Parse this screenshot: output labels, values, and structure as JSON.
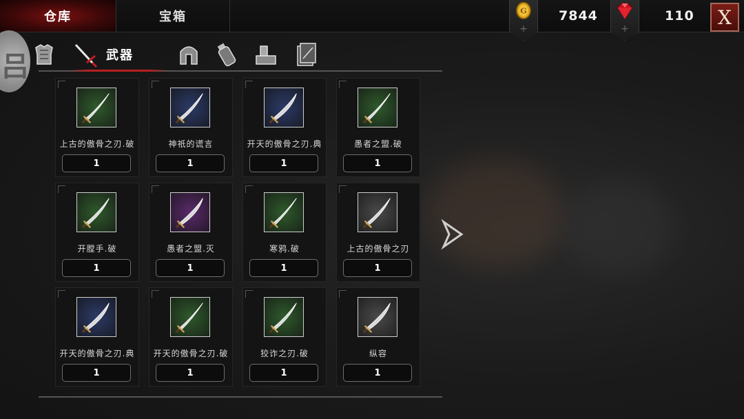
{
  "topbar": {
    "tabs": [
      {
        "label": "仓库",
        "active": true
      },
      {
        "label": "宝箱",
        "active": false
      }
    ],
    "gold": {
      "icon": "gold-coin-icon",
      "value": "7844"
    },
    "gems": {
      "icon": "red-gem-icon",
      "value": "110"
    },
    "close_label": "X"
  },
  "categories": [
    {
      "icon": "armor-icon",
      "label": ""
    },
    {
      "icon": "sword-icon",
      "label": "武器",
      "active": true
    },
    {
      "icon": "helmet-icon",
      "label": ""
    },
    {
      "icon": "potion-icon",
      "label": ""
    },
    {
      "icon": "anvil-icon",
      "label": ""
    },
    {
      "icon": "scroll-card-icon",
      "label": ""
    }
  ],
  "items": [
    {
      "name": "上古的傲骨之刃.破",
      "qty": "1",
      "bg": "#2f5a2c"
    },
    {
      "name": "神祇的谎言",
      "qty": "1",
      "bg": "#2c3a66"
    },
    {
      "name": "开天的傲骨之刃.典",
      "qty": "1",
      "bg": "#2c3a66"
    },
    {
      "name": "愚者之盟.破",
      "qty": "1",
      "bg": "#2f5a2c"
    },
    {
      "name": "开膛手.破",
      "qty": "1",
      "bg": "#2f5a2c"
    },
    {
      "name": "愚者之盟.灭",
      "qty": "1",
      "bg": "#5a2a6a"
    },
    {
      "name": "寒鸦.破",
      "qty": "1",
      "bg": "#2f5a2c"
    },
    {
      "name": "上古的傲骨之刃",
      "qty": "1",
      "bg": "#4a4a4a"
    },
    {
      "name": "开天的傲骨之刃.典",
      "qty": "1",
      "bg": "#2c3a66"
    },
    {
      "name": "开天的傲骨之刃.破",
      "qty": "1",
      "bg": "#2f5a2c"
    },
    {
      "name": "狡诈之刃.破",
      "qty": "1",
      "bg": "#2f5a2c"
    },
    {
      "name": "纵容",
      "qty": "1",
      "bg": "#4a4a4a"
    }
  ]
}
